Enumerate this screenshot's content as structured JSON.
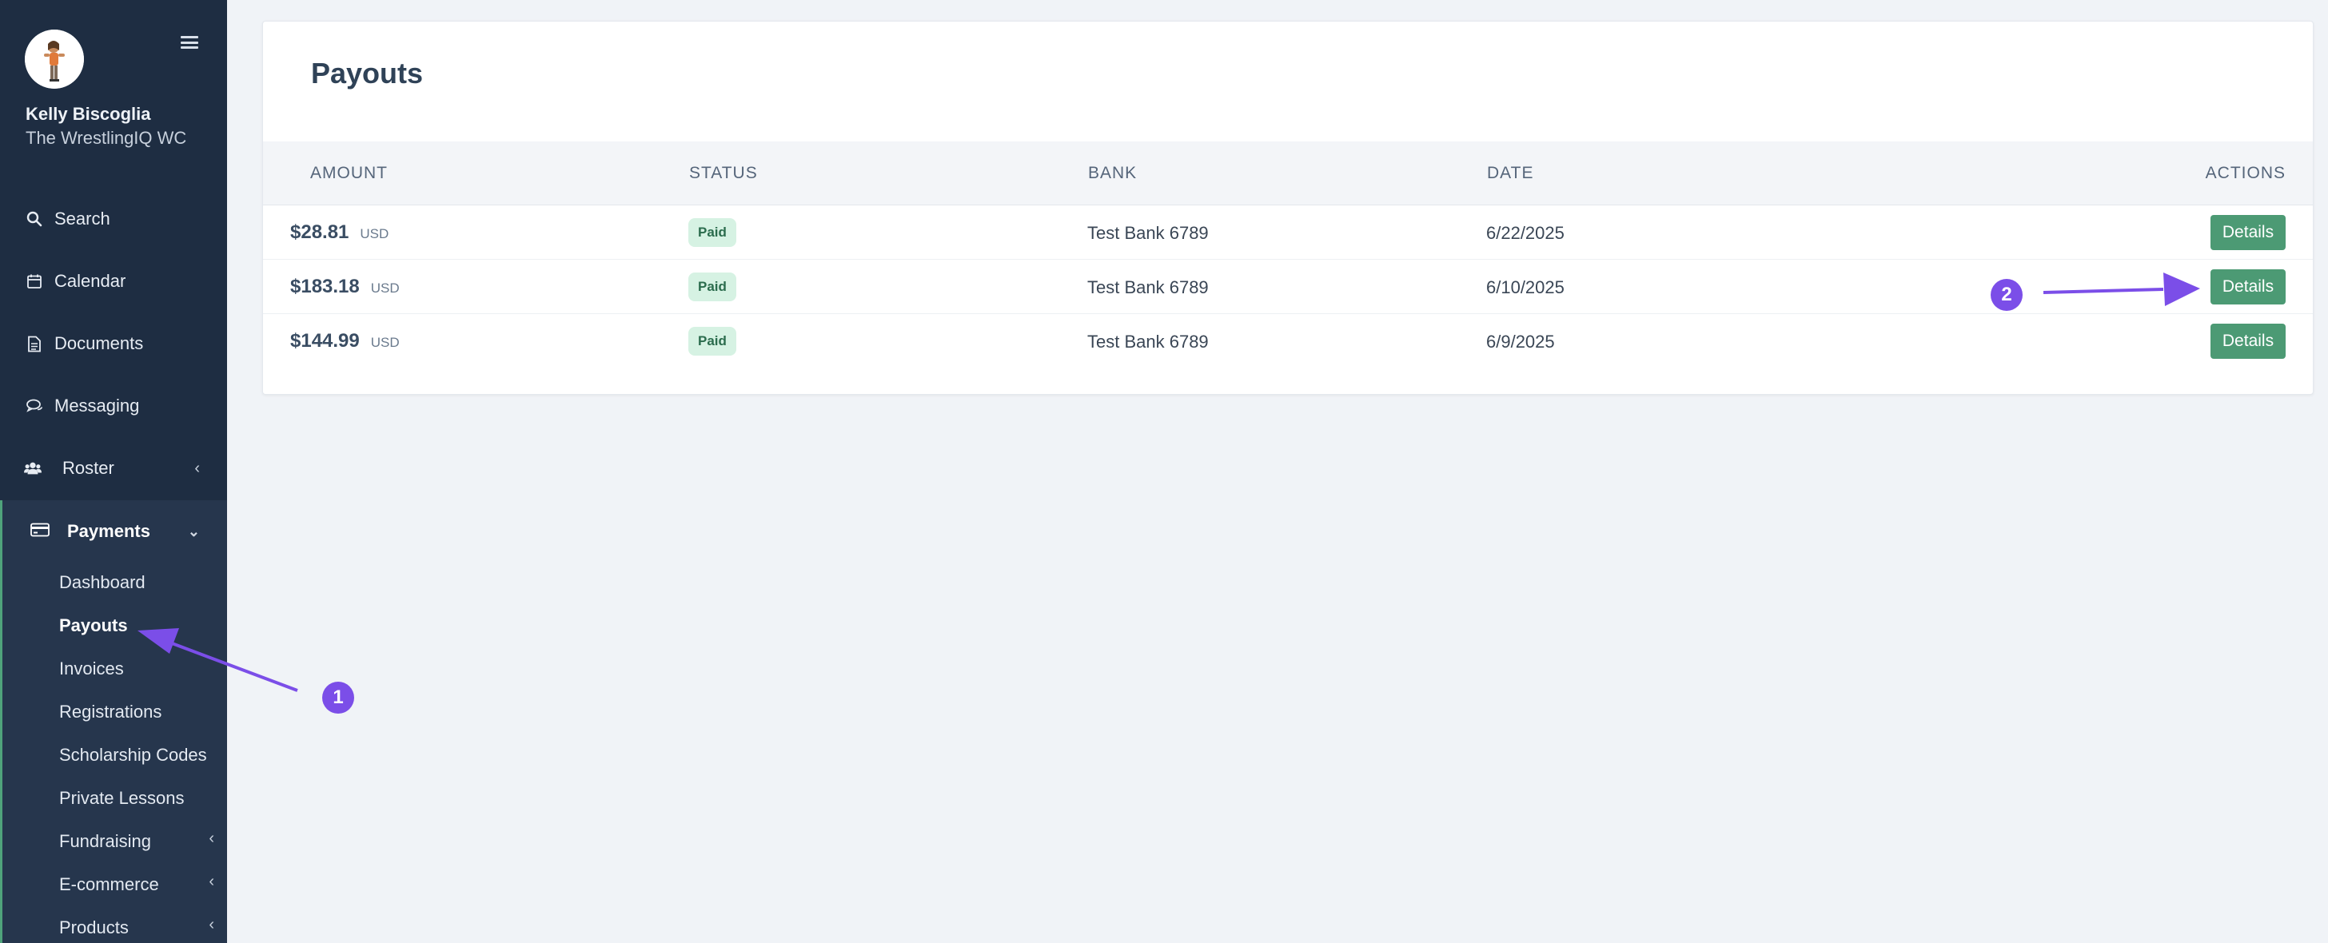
{
  "sidebar": {
    "user_name": "Kelly Biscoglia",
    "team_name": "The WrestlingIQ WC",
    "nav": [
      {
        "label": "Search",
        "icon": "search-icon"
      },
      {
        "label": "Calendar",
        "icon": "calendar-icon"
      },
      {
        "label": "Documents",
        "icon": "document-icon"
      },
      {
        "label": "Messaging",
        "icon": "chat-icon"
      },
      {
        "label": "Roster",
        "icon": "users-icon"
      }
    ],
    "payments": {
      "label": "Payments",
      "icon": "credit-card-icon",
      "sub_items": [
        {
          "label": "Dashboard"
        },
        {
          "label": "Payouts"
        },
        {
          "label": "Invoices"
        },
        {
          "label": "Registrations"
        },
        {
          "label": "Scholarship Codes"
        },
        {
          "label": "Private Lessons"
        },
        {
          "label": "Fundraising"
        },
        {
          "label": "E-commerce"
        },
        {
          "label": "Products"
        }
      ]
    }
  },
  "main": {
    "title": "Payouts",
    "columns": [
      "AMOUNT",
      "STATUS",
      "BANK",
      "DATE",
      "ACTIONS"
    ],
    "rows": [
      {
        "amount": "$28.81",
        "currency": "USD",
        "status": "Paid",
        "bank": "Test Bank 6789",
        "date": "6/22/2025",
        "action": "Details"
      },
      {
        "amount": "$183.18",
        "currency": "USD",
        "status": "Paid",
        "bank": "Test Bank 6789",
        "date": "6/10/2025",
        "action": "Details"
      },
      {
        "amount": "$144.99",
        "currency": "USD",
        "status": "Paid",
        "bank": "Test Bank 6789",
        "date": "6/9/2025",
        "action": "Details"
      }
    ]
  },
  "annotations": [
    {
      "label": "1"
    },
    {
      "label": "2"
    }
  ],
  "colors": {
    "sidebar_bg": "#1e2d42",
    "accent_green": "#4c9a74",
    "annotation_purple": "#7b4ee8"
  }
}
